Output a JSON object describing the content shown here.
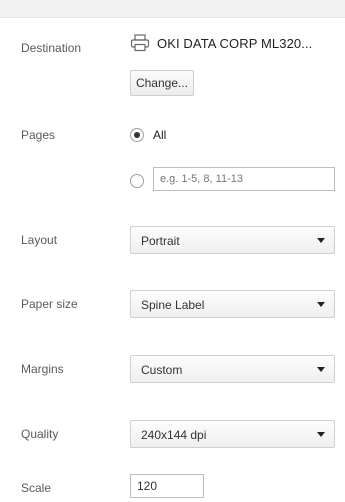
{
  "destination": {
    "label": "Destination",
    "printer_icon": "printer-icon",
    "printer_name": "OKI DATA CORP ML320...",
    "change_button": "Change..."
  },
  "pages": {
    "label": "Pages",
    "all_option": "All",
    "custom_placeholder": "e.g. 1-5, 8, 11-13",
    "selected": "all"
  },
  "layout": {
    "label": "Layout",
    "value": "Portrait"
  },
  "paper_size": {
    "label": "Paper size",
    "value": "Spine Label"
  },
  "margins": {
    "label": "Margins",
    "value": "Custom"
  },
  "quality": {
    "label": "Quality",
    "value": "240x144 dpi"
  },
  "scale": {
    "label": "Scale",
    "value": "120"
  },
  "colors": {
    "text": "#333333",
    "label": "#5a5a5a",
    "border": "#d0d0d0"
  }
}
